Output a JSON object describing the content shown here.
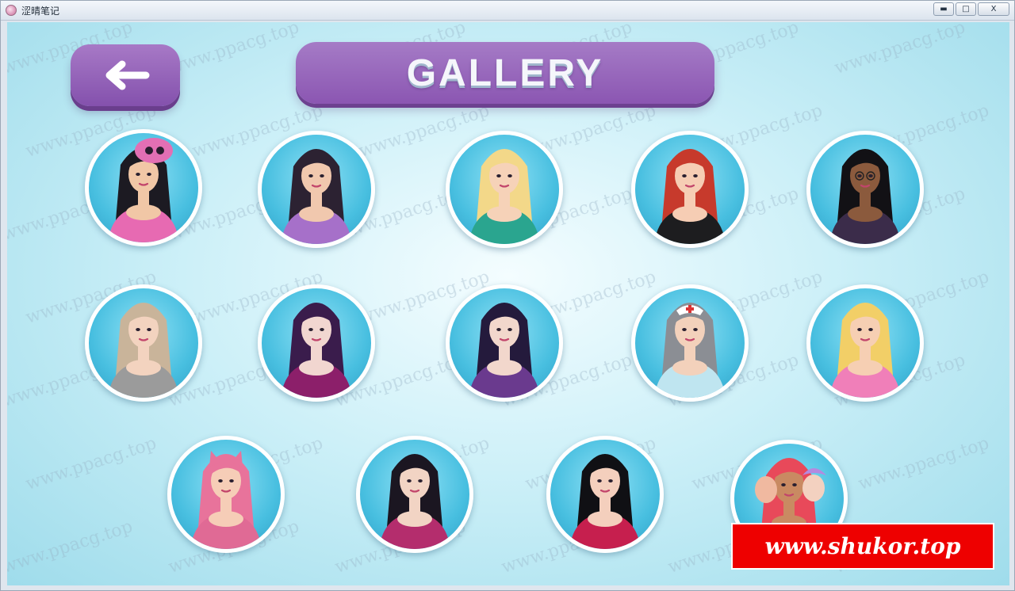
{
  "window": {
    "title": "涩晴笔记",
    "buttons": {
      "minimize": "▬",
      "maximize": "□",
      "close": "X"
    }
  },
  "screen": {
    "title": "GALLERY",
    "back_icon": "left-arrow-icon"
  },
  "watermark_text": "www.ppacg.top",
  "characters": [
    {
      "id": 1,
      "hair": "#1c1a22",
      "skin": "#f1c7a6",
      "outfit": "#e76ab2",
      "accessory": "skull-hat"
    },
    {
      "id": 2,
      "hair": "#2c2232",
      "skin": "#f1c8ae",
      "outfit": "#a670c9",
      "accessory": ""
    },
    {
      "id": 3,
      "hair": "#f3d889",
      "skin": "#f6d2b8",
      "outfit": "#2aa58f",
      "accessory": ""
    },
    {
      "id": 4,
      "hair": "#c73a2c",
      "skin": "#f6cdb4",
      "outfit": "#1d1d1f",
      "accessory": ""
    },
    {
      "id": 5,
      "hair": "#121115",
      "skin": "#8b5a3d",
      "outfit": "#3b2c4a",
      "accessory": "glasses"
    },
    {
      "id": 6,
      "hair": "#c9b49a",
      "skin": "#f3d3bf",
      "outfit": "#9b9b9b",
      "accessory": ""
    },
    {
      "id": 7,
      "hair": "#3a1c4c",
      "skin": "#f1d6d0",
      "outfit": "#8c1f6a",
      "accessory": ""
    },
    {
      "id": 8,
      "hair": "#241a3c",
      "skin": "#f2d7cc",
      "outfit": "#6a3a8e",
      "accessory": ""
    },
    {
      "id": 9,
      "hair": "#8b8e94",
      "skin": "#f3d1bb",
      "outfit": "#bfe5f0",
      "accessory": "nurse-cap"
    },
    {
      "id": 10,
      "hair": "#f2cf67",
      "skin": "#f6cfb3",
      "outfit": "#f07fb9",
      "accessory": ""
    },
    {
      "id": 11,
      "hair": "#e8739b",
      "skin": "#f6cdb7",
      "outfit": "#e06a95",
      "accessory": "cat-ears"
    },
    {
      "id": 12,
      "hair": "#1b1621",
      "skin": "#f2d4c4",
      "outfit": "#b42d6d",
      "accessory": ""
    },
    {
      "id": 13,
      "hair": "#101014",
      "skin": "#f4cfbd",
      "outfit": "#c61f4e",
      "accessory": ""
    },
    {
      "id": 14,
      "hair": "#e8495a",
      "skin": "#c98a62",
      "outfit": "#c03d78",
      "accessory": "group"
    }
  ],
  "promo": {
    "text": "www.shukor.top"
  }
}
